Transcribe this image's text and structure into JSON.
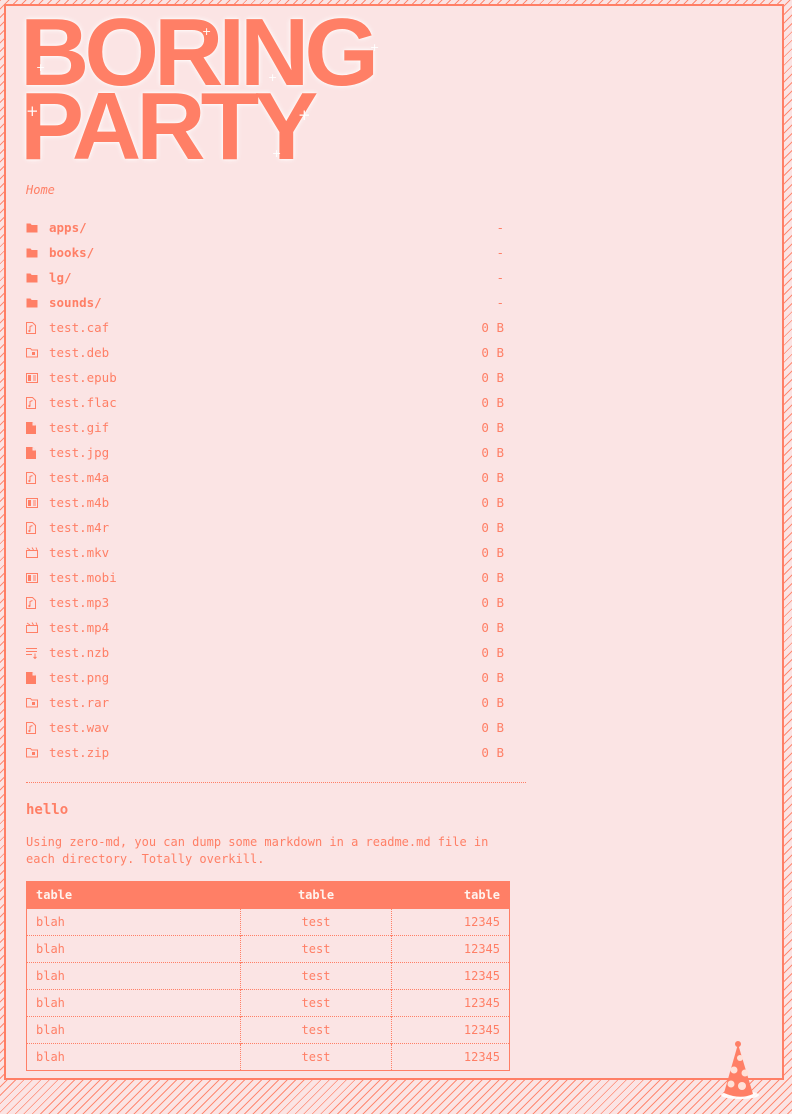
{
  "site": {
    "title_line1": "BORING",
    "title_line2": "PARTY"
  },
  "breadcrumb": "Home",
  "files": [
    {
      "name": "apps/",
      "size": "-",
      "type": "folder",
      "icon": "folder-icon"
    },
    {
      "name": "books/",
      "size": "-",
      "type": "folder",
      "icon": "folder-icon"
    },
    {
      "name": "lg/",
      "size": "-",
      "type": "folder",
      "icon": "folder-icon"
    },
    {
      "name": "sounds/",
      "size": "-",
      "type": "folder",
      "icon": "folder-icon"
    },
    {
      "name": "test.caf",
      "size": "0 B",
      "type": "file",
      "icon": "audio-file-icon"
    },
    {
      "name": "test.deb",
      "size": "0 B",
      "type": "file",
      "icon": "archive-icon"
    },
    {
      "name": "test.epub",
      "size": "0 B",
      "type": "file",
      "icon": "book-icon"
    },
    {
      "name": "test.flac",
      "size": "0 B",
      "type": "file",
      "icon": "audio-file-icon"
    },
    {
      "name": "test.gif",
      "size": "0 B",
      "type": "file",
      "icon": "image-file-icon"
    },
    {
      "name": "test.jpg",
      "size": "0 B",
      "type": "file",
      "icon": "image-file-icon"
    },
    {
      "name": "test.m4a",
      "size": "0 B",
      "type": "file",
      "icon": "audio-file-icon"
    },
    {
      "name": "test.m4b",
      "size": "0 B",
      "type": "file",
      "icon": "book-icon"
    },
    {
      "name": "test.m4r",
      "size": "0 B",
      "type": "file",
      "icon": "audio-file-icon"
    },
    {
      "name": "test.mkv",
      "size": "0 B",
      "type": "file",
      "icon": "video-icon"
    },
    {
      "name": "test.mobi",
      "size": "0 B",
      "type": "file",
      "icon": "book-icon"
    },
    {
      "name": "test.mp3",
      "size": "0 B",
      "type": "file",
      "icon": "audio-file-icon"
    },
    {
      "name": "test.mp4",
      "size": "0 B",
      "type": "file",
      "icon": "video-icon"
    },
    {
      "name": "test.nzb",
      "size": "0 B",
      "type": "file",
      "icon": "download-list-icon"
    },
    {
      "name": "test.png",
      "size": "0 B",
      "type": "file",
      "icon": "image-file-icon"
    },
    {
      "name": "test.rar",
      "size": "0 B",
      "type": "file",
      "icon": "archive-icon"
    },
    {
      "name": "test.wav",
      "size": "0 B",
      "type": "file",
      "icon": "audio-file-icon"
    },
    {
      "name": "test.zip",
      "size": "0 B",
      "type": "file",
      "icon": "archive-icon"
    }
  ],
  "readme": {
    "heading": "hello",
    "text": "Using zero-md, you can dump some markdown in a readme.md file in each directory. Totally overkill.",
    "table": {
      "headers": [
        "table",
        "table",
        "table"
      ],
      "rows": [
        [
          "blah",
          "test",
          "12345"
        ],
        [
          "blah",
          "test",
          "12345"
        ],
        [
          "blah",
          "test",
          "12345"
        ],
        [
          "blah",
          "test",
          "12345"
        ],
        [
          "blah",
          "test",
          "12345"
        ],
        [
          "blah",
          "test",
          "12345"
        ]
      ]
    }
  },
  "mascot_icon": "party-hat-icon",
  "colors": {
    "accent": "#ff7f66",
    "background": "#fbe4e4",
    "header_text": "#fff3ee"
  }
}
